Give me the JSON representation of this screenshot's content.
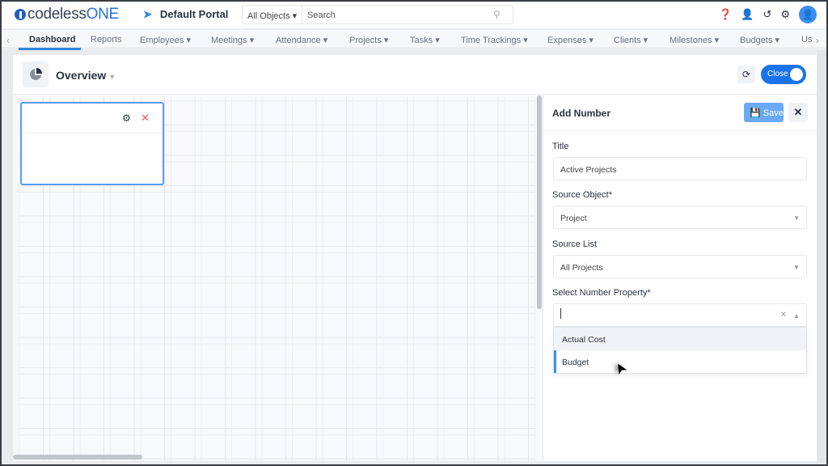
{
  "app": {
    "logo": "codelessONE",
    "portal": "Default Portal"
  },
  "search": {
    "scope": "All Objects",
    "placeholder": "Search"
  },
  "header_icons": [
    "help-icon",
    "add-user-icon",
    "history-icon",
    "settings-icon",
    "avatar-icon"
  ],
  "nav": {
    "items": [
      {
        "label": "Dashboard",
        "active": true,
        "dropdown": false
      },
      {
        "label": "Reports",
        "dropdown": false
      },
      {
        "label": "Employees",
        "dropdown": true
      },
      {
        "label": "Meetings",
        "dropdown": true
      },
      {
        "label": "Attendance",
        "dropdown": true
      },
      {
        "label": "Projects",
        "dropdown": true
      },
      {
        "label": "Tasks",
        "dropdown": true
      },
      {
        "label": "Time Trackings",
        "dropdown": true
      },
      {
        "label": "Expenses",
        "dropdown": true
      },
      {
        "label": "Clients",
        "dropdown": true
      },
      {
        "label": "Milestones",
        "dropdown": true
      },
      {
        "label": "Budgets",
        "dropdown": true
      },
      {
        "label": "Us",
        "dropdown": false
      }
    ]
  },
  "dashboard": {
    "title": "Overview",
    "close_toggle": "Close"
  },
  "panel": {
    "title": "Add Number",
    "save": "Save",
    "title_label": "Title",
    "title_value": "Active Projects",
    "source_object_label": "Source Object*",
    "source_object_value": "Project",
    "source_list_label": "Source List",
    "source_list_value": "All Projects",
    "number_property_label": "Select Number Property*",
    "number_property_value": "",
    "options": [
      "Actual Cost",
      "Budget"
    ]
  },
  "colors": {
    "accent": "#1a73e8",
    "save_disabled": "#6aaaf5",
    "widget_border": "#5b9df5",
    "delete": "#f05a5a"
  }
}
